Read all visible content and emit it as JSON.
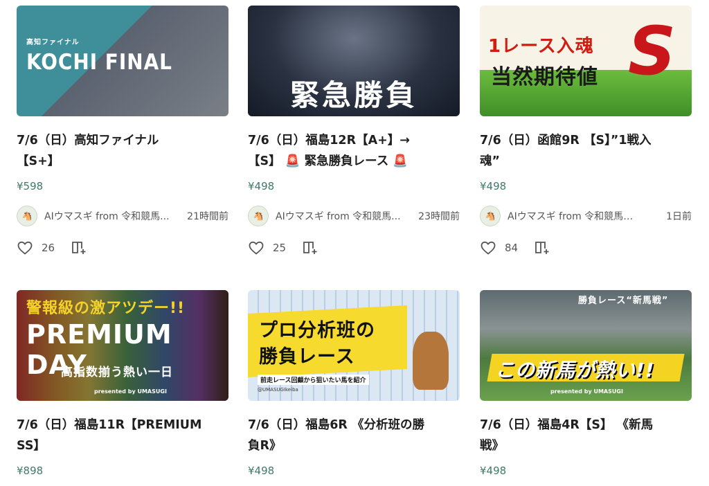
{
  "cards": [
    {
      "thumb_lines": [
        "高知ファイナル",
        "KOCHI FINAL"
      ],
      "title_line1": "7/6（日）高知ファイナル",
      "title_line2": "【S+】",
      "price": "¥598",
      "author": "AIウマスギ from 令和競馬...",
      "time": "21時間前",
      "likes": "26",
      "colors": {
        "bg1": "#3f8f9a",
        "bg2": "#2b3a44"
      }
    },
    {
      "thumb_lines": [
        "緊急勝負"
      ],
      "title_line1": "7/6（日）福島12R【A+】→",
      "title_line2": "【S】 🚨 緊急勝負レース 🚨",
      "price": "¥498",
      "author": "AIウマスギ from 令和競馬...",
      "time": "23時間前",
      "likes": "25",
      "colors": {
        "bg1": "#1b2231",
        "bg2": "#3b4558"
      }
    },
    {
      "thumb_lines": [
        "1レース入魂",
        "当然期待値",
        "S"
      ],
      "title_line1": "7/6（日）函館9R 【S】”1戦入",
      "title_line2": "魂”",
      "price": "¥498",
      "author": "AIウマスギ from 令和競馬研...",
      "time": "1日前",
      "likes": "84",
      "colors": {
        "bg1": "#62b43c",
        "bg2": "#e23a1c"
      }
    },
    {
      "thumb_lines": [
        "警報級の激アツデー!!",
        "PREMIUM DAY",
        "高指数揃う熱い一日",
        "presented by UMASUGI"
      ],
      "title_line1": "7/6（日）福島11R【PREMIUM",
      "title_line2": "SS】",
      "price": "¥898",
      "author": "",
      "time": "",
      "likes": "",
      "colors": {
        "bg1": "#3a2418",
        "bg2": "#6a3e26"
      }
    },
    {
      "thumb_lines": [
        "プロ分析班の",
        "勝負レース",
        "前走レース回顧から狙いたい馬を紹介",
        "@UMASUGIkeiba"
      ],
      "title_line1": "7/6（日）福島6R 《分析班の勝",
      "title_line2": "負R》",
      "price": "¥498",
      "author": "",
      "time": "",
      "likes": "",
      "colors": {
        "bg1": "#dfe9f5",
        "bg2": "#f4d82e"
      }
    },
    {
      "thumb_lines": [
        "勝負レース“新馬戦”",
        "この新馬が熱い!!",
        "presented by UMASUGI"
      ],
      "title_line1": "7/6（日）福島4R【S】 《新馬",
      "title_line2": "戦》",
      "price": "¥498",
      "author": "",
      "time": "",
      "likes": "",
      "colors": {
        "bg1": "#2f5a2a",
        "bg2": "#7aa86a"
      }
    }
  ]
}
